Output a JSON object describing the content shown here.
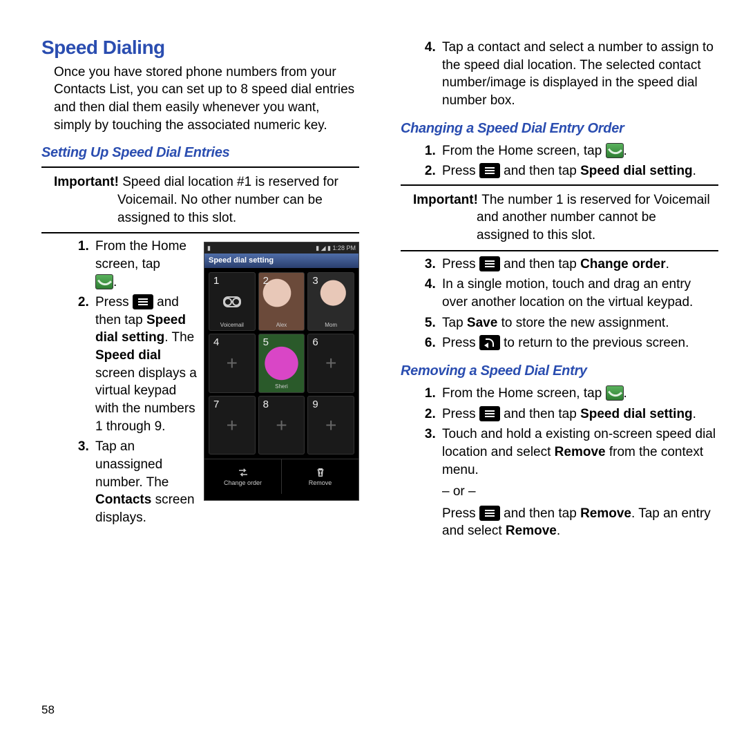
{
  "page_number": "58",
  "title": "Speed Dialing",
  "intro": "Once you have stored phone numbers from your Contacts List, you can set up to 8 speed dial entries and then dial them easily whenever you want, simply by touching the associated numeric key.",
  "sub_setting": "Setting Up Speed Dial Entries",
  "important1_label": "Important! ",
  "important1_a": "Speed dial location #1 is reserved for",
  "important1_b": "Voicemail. No other number can be",
  "important1_c": "assigned to this slot.",
  "step1_a": "From the Home screen, tap ",
  "step1_b": ".",
  "step2_a": "Press ",
  "step2_b": " and then tap ",
  "step2_c": "Speed dial setting",
  "step2_d": ". The ",
  "step2_e": "Speed dial",
  "step2_f": " screen displays a virtual keypad with the numbers 1 through 9.",
  "step3_a": "Tap an unassigned number. The ",
  "step3_b": "Contacts",
  "step3_c": " screen displays.",
  "step4": "Tap a contact and select a number to assign to the speed dial location. The selected contact number/image is displayed in the speed dial number box.",
  "sub_change": "Changing a Speed Dial Entry Order",
  "c1_a": "From the Home screen, tap ",
  "c1_b": ".",
  "c2_a": "Press ",
  "c2_b": " and then tap ",
  "c2_c": "Speed dial setting",
  "c2_d": ".",
  "important2_label": "Important! ",
  "important2_a": "The number 1 is reserved for Voicemail",
  "important2_b": "and another number cannot be",
  "important2_c": "assigned to this slot.",
  "c3_a": "Press ",
  "c3_b": " and then tap ",
  "c3_c": "Change order",
  "c3_d": ".",
  "c4": "In a single motion, touch and drag an entry over another location on the virtual keypad.",
  "c5_a": "Tap ",
  "c5_b": "Save",
  "c5_c": " to store the new assignment.",
  "c6_a": "Press ",
  "c6_b": " to return to the previous screen.",
  "sub_remove": "Removing a Speed Dial Entry",
  "r1_a": "From the Home screen, tap ",
  "r1_b": ".",
  "r2_a": "Press ",
  "r2_b": " and then tap ",
  "r2_c": "Speed dial setting",
  "r2_d": ".",
  "r3_a": "Touch and hold a existing on-screen speed dial location and select ",
  "r3_b": "Remove",
  "r3_c": " from the context menu.",
  "or": "– or –",
  "r3_d": "Press ",
  "r3_e": " and then tap ",
  "r3_f": "Remove",
  "r3_g": ". Tap an entry and select ",
  "r3_h": "Remove",
  "r3_i": ".",
  "shot": {
    "time": "1:28 PM",
    "title": "Speed dial setting",
    "cells": [
      {
        "num": "1",
        "label": "Voicemail"
      },
      {
        "num": "2",
        "label": "Alex"
      },
      {
        "num": "3",
        "label": "Mom"
      },
      {
        "num": "4",
        "label": ""
      },
      {
        "num": "5",
        "label": "Sheri"
      },
      {
        "num": "6",
        "label": ""
      },
      {
        "num": "7",
        "label": ""
      },
      {
        "num": "8",
        "label": ""
      },
      {
        "num": "9",
        "label": ""
      }
    ],
    "btn1": "Change order",
    "btn2": "Remove"
  }
}
